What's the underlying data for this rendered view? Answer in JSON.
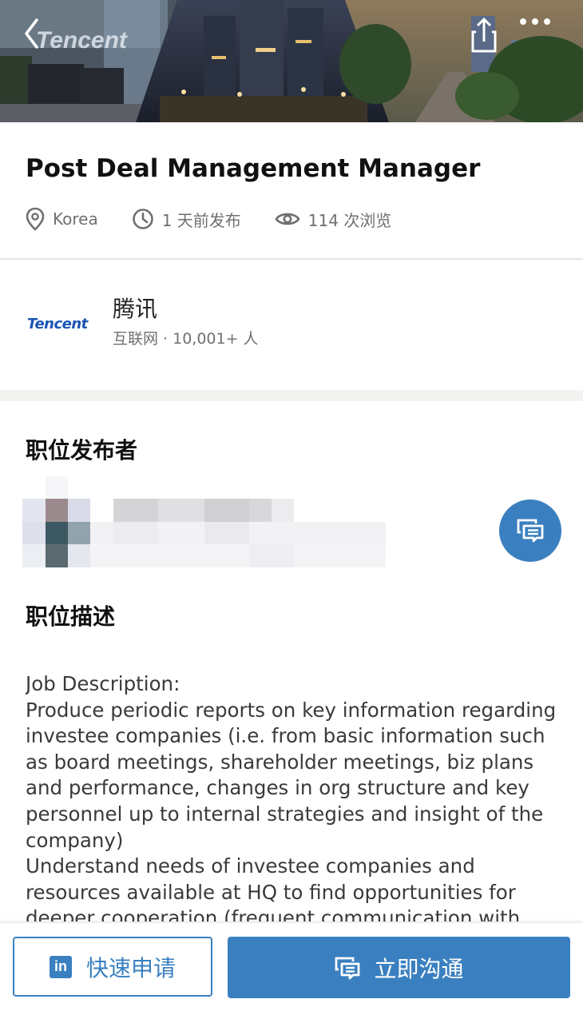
{
  "header": {
    "back_icon": "chevron-left-icon",
    "share_icon": "share-icon",
    "more_icon": "more-horizontal-icon",
    "hero_sign_text": "Tencent"
  },
  "job": {
    "title": "Post Deal Management Manager",
    "location": "Korea",
    "posted": "1 天前发布",
    "views": "114 次浏览"
  },
  "company": {
    "logo_text": "Tencent",
    "name": "腾讯",
    "subtitle": "互联网 · 10,001+ 人"
  },
  "poster": {
    "heading": "职位发布者",
    "message_icon": "message-icon"
  },
  "description": {
    "heading": "职位描述",
    "body": "Job Description:\nProduce periodic reports on key information regarding investee companies (i.e. from basic information such as board meetings, shareholder meetings, biz plans and performance, changes in org structure and key personnel up to internal strategies and insight of the company)\nUnderstand needs of investee companies and resources available at HQ to find opportunities for deeper cooperation (frequent communication with"
  },
  "actions": {
    "quick_apply": "快速申请",
    "chat_now": "立即沟通"
  },
  "colors": {
    "accent": "#3a80c0",
    "logo_blue": "#1a54b5"
  }
}
